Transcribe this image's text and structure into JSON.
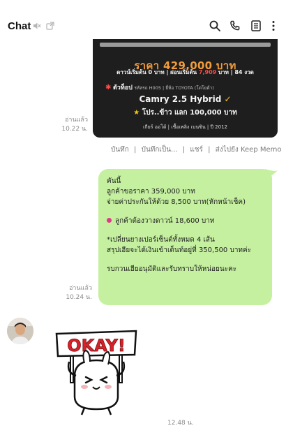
{
  "header": {
    "title": "Chat",
    "icons": [
      "muted-icon",
      "popout-icon",
      "search-icon",
      "phone-icon",
      "notes-icon",
      "more-icon"
    ]
  },
  "card": {
    "price": "ราคา 429,000 บาท",
    "down_prefix": "ดาวน์เริ่มต้น 0 บาท | ผ่อนเริ่มต้น",
    "down_amount": "7,909",
    "down_suffix": "บาท | 84 งวด",
    "highlight_label": "ตัวท็อป",
    "spec_line": "รหัสรถ  H005 | ยี่ห้อ  TOYOTA (โตโยต้า)",
    "model": "Camry 2.5 Hybrid",
    "promo": "โปร..ข้าว แลก 100,000 บาท",
    "footer": "เกียร์ ออโต้  |  เชื้อเพลิง เบนซิน  |  ปี 2012"
  },
  "msg1": {
    "read": "อ่านแล้ว",
    "time": "10.22 น."
  },
  "actions": [
    "บันทึก",
    "|",
    "บันทึกเป็น...",
    "|",
    "แชร์",
    "|",
    "ส่งไปยัง Keep Memo"
  ],
  "bubble": {
    "line1": "คันนี้",
    "line2": "ลูกค้าขอราคา 359,000 บาท",
    "line3": "จ่ายค่าประกันให้ด้วย 8,500 บาท(หักหน้าเช็ค)",
    "line4": "ลูกค้าต้องวางดาวน์ 18,600 บาท",
    "line5": "*เปลี่ยนยางเปอร์เซ็นต์ทั้งหมด 4 เส้น",
    "line6": "สรุปเฮียจะได้เงินเข้าเต็นท์อยู่ที่ 350,500 บาทค่ะ",
    "line7": "รบกวนเฮียอนุมัติและรับทราบให้หน่อยนะคะ"
  },
  "msg2": {
    "read": "อ่านแล้ว",
    "time": "10.24 น."
  },
  "sticker": {
    "text": "OKAY!"
  },
  "msg3": {
    "time": "12.48 น."
  },
  "colors": {
    "bubble": "#c5f0a0",
    "price": "#f29b3a",
    "accent_red": "#ff4a4a"
  }
}
